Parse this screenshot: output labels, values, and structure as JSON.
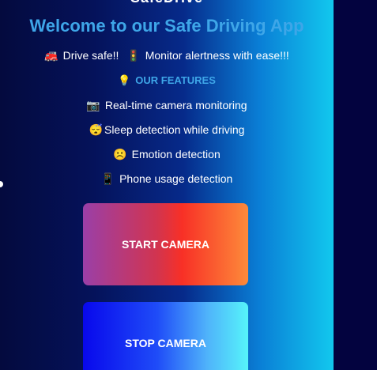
{
  "header": {
    "cut_title": "SafeDrive",
    "welcome": "Welcome to our Safe Driving App"
  },
  "tagline": {
    "icon_left": "🚒",
    "text_left": "Drive safe!!",
    "icon_mid": "🚦",
    "text_right": "Monitor alertness with ease!!!"
  },
  "features": {
    "heading_icon": "💡",
    "heading": "OUR FEATURES",
    "items": [
      {
        "icon": "📷",
        "label": "Real-time camera monitoring"
      },
      {
        "icon": "😴",
        "label": "Sleep detection while driving"
      },
      {
        "icon": "☹️",
        "label": "Emotion detection"
      },
      {
        "icon": "📱",
        "label": "Phone usage detection"
      }
    ]
  },
  "buttons": {
    "start_label": "START CAMERA",
    "stop_label": "STOP CAMERA"
  }
}
